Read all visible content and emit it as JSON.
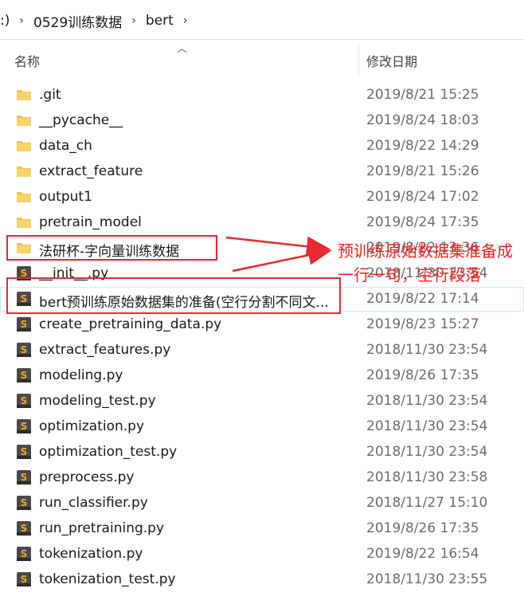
{
  "breadcrumb": {
    "prefix": ":)",
    "items": [
      "0529训练数据",
      "bert"
    ],
    "separator": "›"
  },
  "columns": {
    "name": "名称",
    "date_modified": "修改日期"
  },
  "files": [
    {
      "name": ".git",
      "date": "2019/8/21 15:25",
      "type": "folder"
    },
    {
      "name": "__pycache__",
      "date": "2019/8/24 18:03",
      "type": "folder"
    },
    {
      "name": "data_ch",
      "date": "2019/8/22 14:29",
      "type": "folder"
    },
    {
      "name": "extract_feature",
      "date": "2019/8/21 15:26",
      "type": "folder"
    },
    {
      "name": "output1",
      "date": "2019/8/24 17:02",
      "type": "folder"
    },
    {
      "name": "pretrain_model",
      "date": "2019/8/24 17:35",
      "type": "folder"
    },
    {
      "name": "法研杯-字向量训练数据",
      "date": "2019/8/22 13:36",
      "type": "folder"
    },
    {
      "name": "__init__.py",
      "date": "2018/11/30 23:54",
      "type": "py"
    },
    {
      "name": "bert预训练原始数据集的准备(空行分割不同文...",
      "date": "2019/8/22 17:14",
      "type": "py"
    },
    {
      "name": "create_pretraining_data.py",
      "date": "2019/8/23 15:27",
      "type": "py"
    },
    {
      "name": "extract_features.py",
      "date": "2018/11/30 23:54",
      "type": "py"
    },
    {
      "name": "modeling.py",
      "date": "2019/8/26 17:35",
      "type": "py"
    },
    {
      "name": "modeling_test.py",
      "date": "2018/11/30 23:54",
      "type": "py"
    },
    {
      "name": "optimization.py",
      "date": "2018/11/30 23:54",
      "type": "py"
    },
    {
      "name": "optimization_test.py",
      "date": "2018/11/30 23:54",
      "type": "py"
    },
    {
      "name": "preprocess.py",
      "date": "2018/11/30 23:58",
      "type": "py"
    },
    {
      "name": "run_classifier.py",
      "date": "2018/11/27 15:10",
      "type": "py"
    },
    {
      "name": "run_pretraining.py",
      "date": "2019/8/26 17:35",
      "type": "py"
    },
    {
      "name": "tokenization.py",
      "date": "2019/8/22 16:54",
      "type": "py"
    },
    {
      "name": "tokenization_test.py",
      "date": "2018/11/30 23:55",
      "type": "py"
    }
  ],
  "annotation": {
    "text": "预训练原始数据集准备成一行一句，空行段落"
  },
  "colors": {
    "annotation": "#e8292d",
    "folder": "#f3c24f",
    "sublime": "#4a4a4a"
  }
}
